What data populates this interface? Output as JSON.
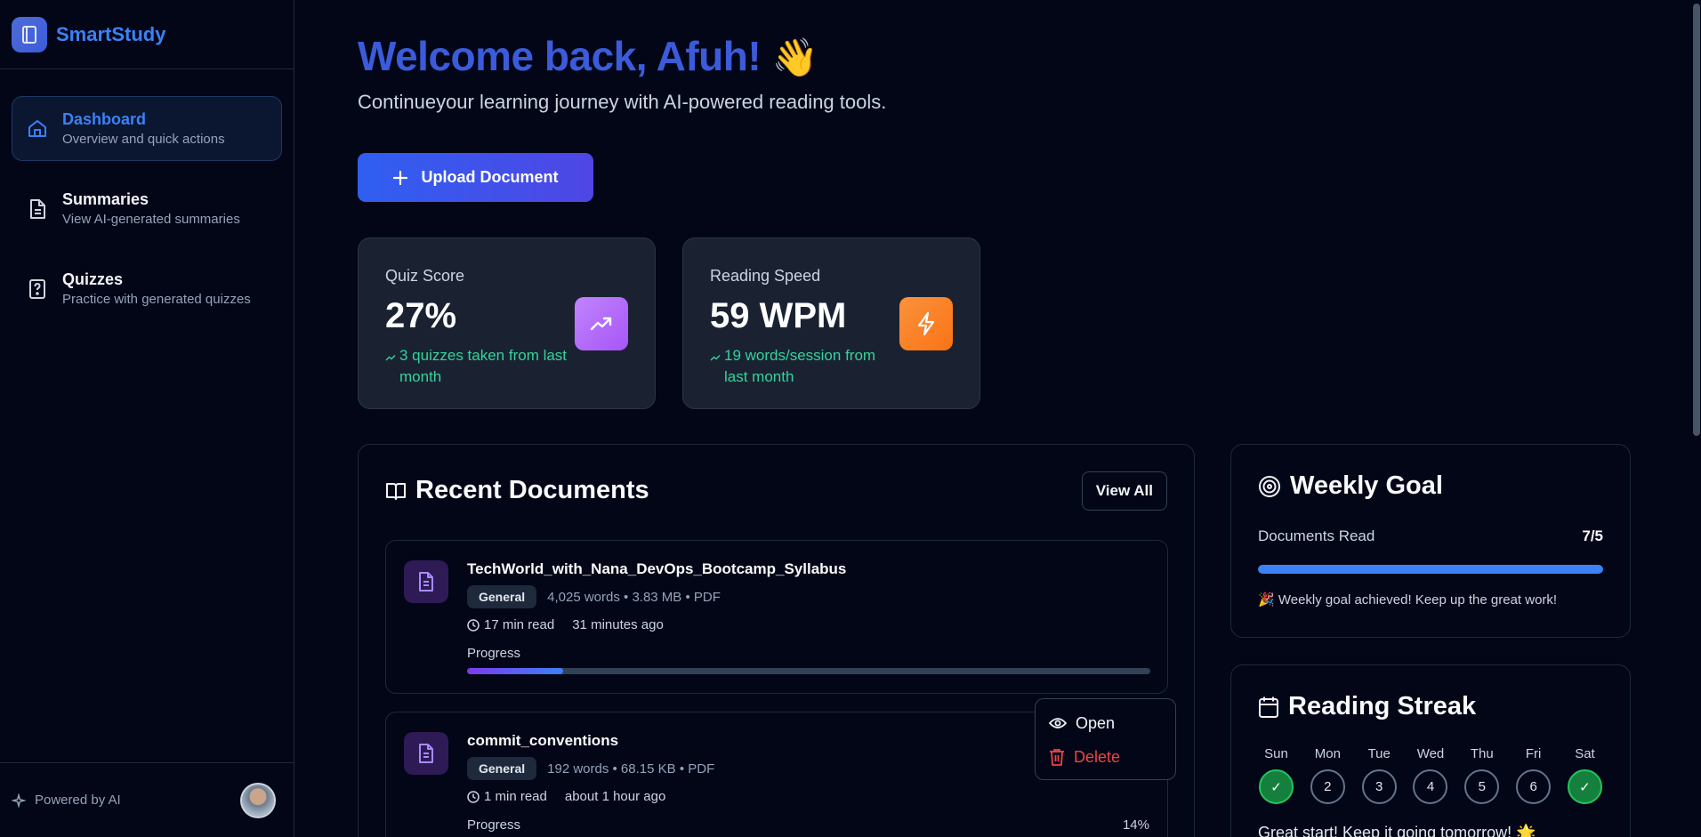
{
  "brand": {
    "name": "SmartStudy"
  },
  "nav": {
    "items": [
      {
        "title": "Dashboard",
        "subtitle": "Overview and quick actions",
        "active": true
      },
      {
        "title": "Summaries",
        "subtitle": "View AI-generated summaries"
      },
      {
        "title": "Quizzes",
        "subtitle": "Practice with generated quizzes"
      }
    ]
  },
  "footer": {
    "powered": "Powered by AI"
  },
  "header": {
    "welcome": "Welcome back, Afuh!",
    "emoji": "👋",
    "tagline": "Continueyour learning journey with AI-powered reading tools."
  },
  "actions": {
    "upload": "Upload Document"
  },
  "stats": [
    {
      "label": "Quiz Score",
      "value": "27%",
      "trend": "3 quizzes taken from last month",
      "color": "#a855f7"
    },
    {
      "label": "Reading Speed",
      "value": "59 WPM",
      "trend": "19 words/session from last month",
      "color": "#f97316"
    }
  ],
  "recent": {
    "title": "Recent Documents",
    "view_all": "View All",
    "docs": [
      {
        "name": "TechWorld_with_Nana_DevOps_Bootcamp_Syllabus",
        "tag": "General",
        "meta": "4,025 words • 3.83 MB • PDF",
        "read_time": "17 min read",
        "ago": "31 minutes ago",
        "progress_label": "Progress",
        "progress_pct": "",
        "progress": 0.14
      },
      {
        "name": "commit_conventions",
        "tag": "General",
        "meta": "192 words • 68.15 KB • PDF",
        "read_time": "1 min read",
        "ago": "about 1 hour ago",
        "progress_label": "Progress",
        "progress_pct": "14%",
        "progress": 0.14
      }
    ],
    "menu": {
      "open": "Open",
      "delete": "Delete"
    }
  },
  "weekly_goal": {
    "title": "Weekly Goal",
    "label": "Documents Read",
    "value": "7/5",
    "progress": 1.0,
    "message": "🎉 Weekly goal achieved! Keep up the great work!"
  },
  "streak": {
    "title": "Reading Streak",
    "days": [
      {
        "label": "Sun",
        "mark": "✓",
        "done": true
      },
      {
        "label": "Mon",
        "mark": "2",
        "done": false
      },
      {
        "label": "Tue",
        "mark": "3",
        "done": false
      },
      {
        "label": "Wed",
        "mark": "4",
        "done": false
      },
      {
        "label": "Thu",
        "mark": "5",
        "done": false
      },
      {
        "label": "Fri",
        "mark": "6",
        "done": false
      },
      {
        "label": "Sat",
        "mark": "✓",
        "done": true
      }
    ],
    "message": "Great start! Keep it going tomorrow! 🌟"
  },
  "colors": {
    "accent": "#3b82f6",
    "brand": "#3b5bdb",
    "success": "#22c55e",
    "danger": "#ef4444"
  }
}
